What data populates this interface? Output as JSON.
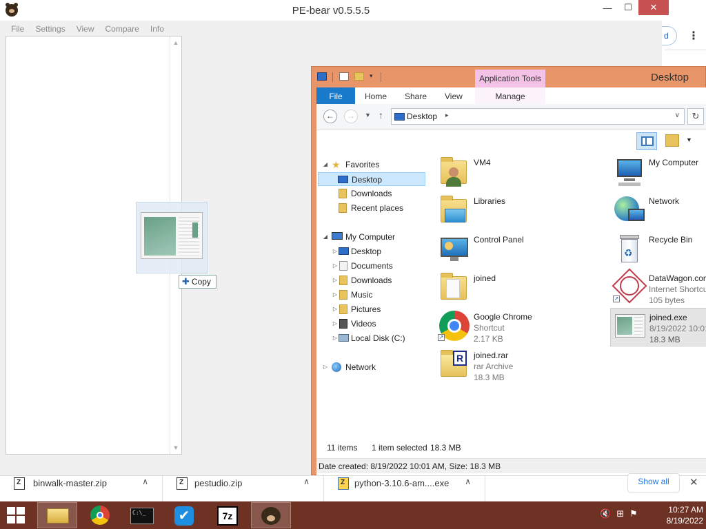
{
  "pebear": {
    "title": "PE-bear v0.5.5.5",
    "menu": [
      "File",
      "Settings",
      "View",
      "Compare",
      "Info"
    ],
    "controls": {
      "minimize": "—",
      "maximize": "☐",
      "close": "✕"
    }
  },
  "drag": {
    "tip": "Copy"
  },
  "chrome": {
    "button_fragment": "d",
    "menu_glyph": "⋮"
  },
  "explorer": {
    "title": "Desktop",
    "app_tools": "Application Tools",
    "tabs": [
      "File",
      "Home",
      "Share",
      "View",
      "Manage"
    ],
    "address": "Desktop",
    "nav": {
      "favorites": "Favorites",
      "favorites_items": [
        "Desktop",
        "Downloads",
        "Recent places"
      ],
      "computer": "My Computer",
      "computer_items": [
        "Desktop",
        "Documents",
        "Downloads",
        "Music",
        "Pictures",
        "Videos",
        "Local Disk (C:)"
      ],
      "network": "Network"
    },
    "items": [
      {
        "name": "VM4",
        "line2": "",
        "line3": ""
      },
      {
        "name": "Libraries",
        "line2": "",
        "line3": ""
      },
      {
        "name": "Control Panel",
        "line2": "",
        "line3": ""
      },
      {
        "name": "joined",
        "line2": "",
        "line3": ""
      },
      {
        "name": "Google Chrome",
        "line2": "Shortcut",
        "line3": "2.17 KB"
      },
      {
        "name": "joined.rar",
        "line2": "rar Archive",
        "line3": "18.3 MB"
      },
      {
        "name": "My Computer",
        "line2": "",
        "line3": ""
      },
      {
        "name": "Network",
        "line2": "",
        "line3": ""
      },
      {
        "name": "Recycle Bin",
        "line2": "",
        "line3": ""
      },
      {
        "name": "DataWagon.com",
        "line2": "Internet Shortcut",
        "line3": "105 bytes"
      },
      {
        "name": "joined.exe",
        "line2": "8/19/2022 10:01 AM",
        "line3": "18.3 MB"
      }
    ],
    "status": {
      "count": "11 items",
      "selected": "1 item selected",
      "size": "18.3 MB"
    },
    "details": "Date created: 8/19/2022 10:01 AM, Size: 18.3 MB"
  },
  "downloads": {
    "items": [
      "binwalk-master.zip",
      "pestudio.zip",
      "python-3.10.6-am....exe"
    ],
    "show_all": "Show all",
    "close": "✕"
  },
  "taskbar": {
    "time": "10:27 AM",
    "date": "8/19/2022",
    "apps": [
      "file-explorer",
      "chrome",
      "command-prompt",
      "task-app",
      "7zip",
      "pe-bear"
    ],
    "seven_zip_label": "7z"
  }
}
